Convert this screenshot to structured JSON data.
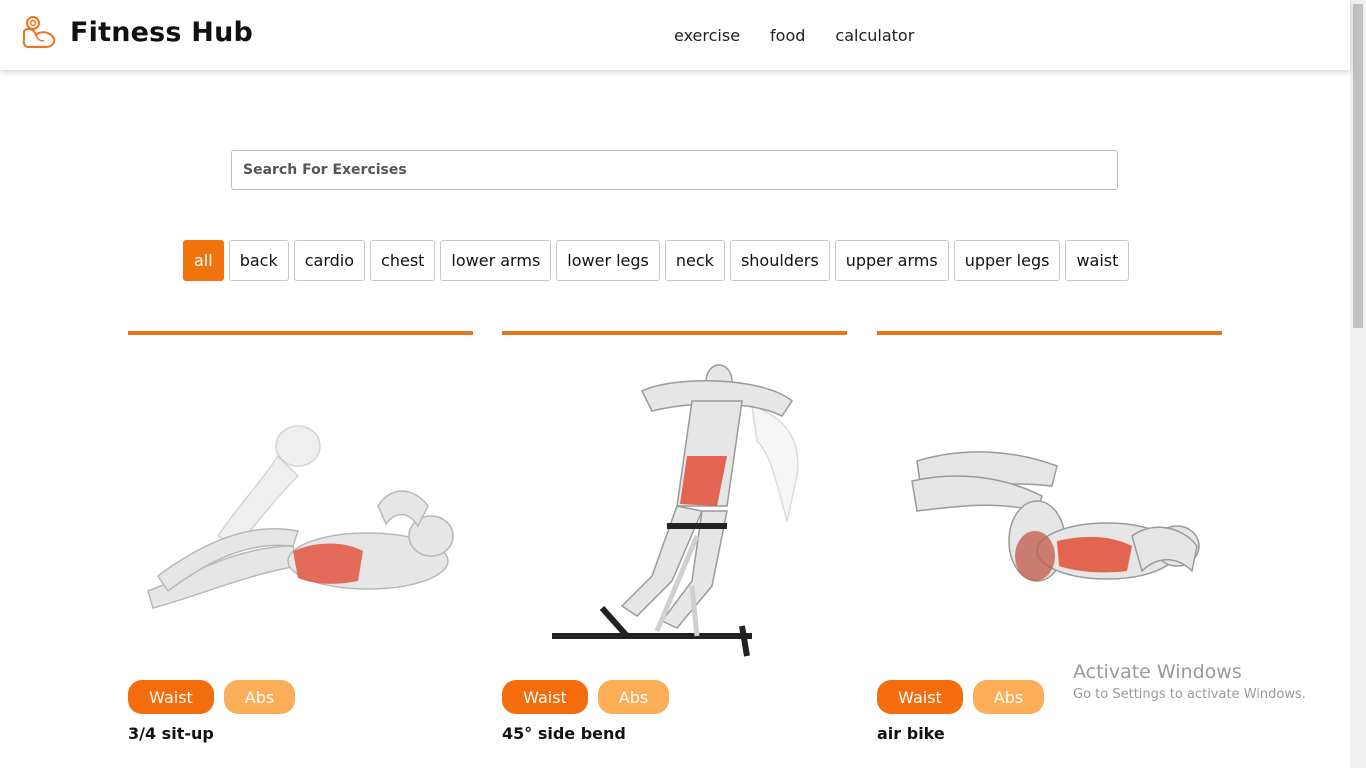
{
  "header": {
    "brand": "Fitness Hub",
    "nav": [
      "exercise",
      "food",
      "calculator"
    ]
  },
  "search": {
    "placeholder": "Search For Exercises",
    "value": ""
  },
  "filters": {
    "items": [
      "all",
      "back",
      "cardio",
      "chest",
      "lower arms",
      "lower legs",
      "neck",
      "shoulders",
      "upper arms",
      "upper legs",
      "waist"
    ],
    "active": "all"
  },
  "exercises": [
    {
      "name": "3/4 sit-up",
      "tags": [
        "Waist",
        "Abs"
      ]
    },
    {
      "name": "45° side bend",
      "tags": [
        "Waist",
        "Abs"
      ]
    },
    {
      "name": "air bike",
      "tags": [
        "Waist",
        "Abs"
      ]
    }
  ],
  "colors": {
    "accent": "#f0730d",
    "tag_primary": "#f46c0e",
    "tag_secondary": "#fcad57",
    "card_bar": "#e8741b",
    "muscle_highlight": "#e2553f"
  },
  "watermark": {
    "title": "Activate Windows",
    "subtitle": "Go to Settings to activate Windows."
  }
}
